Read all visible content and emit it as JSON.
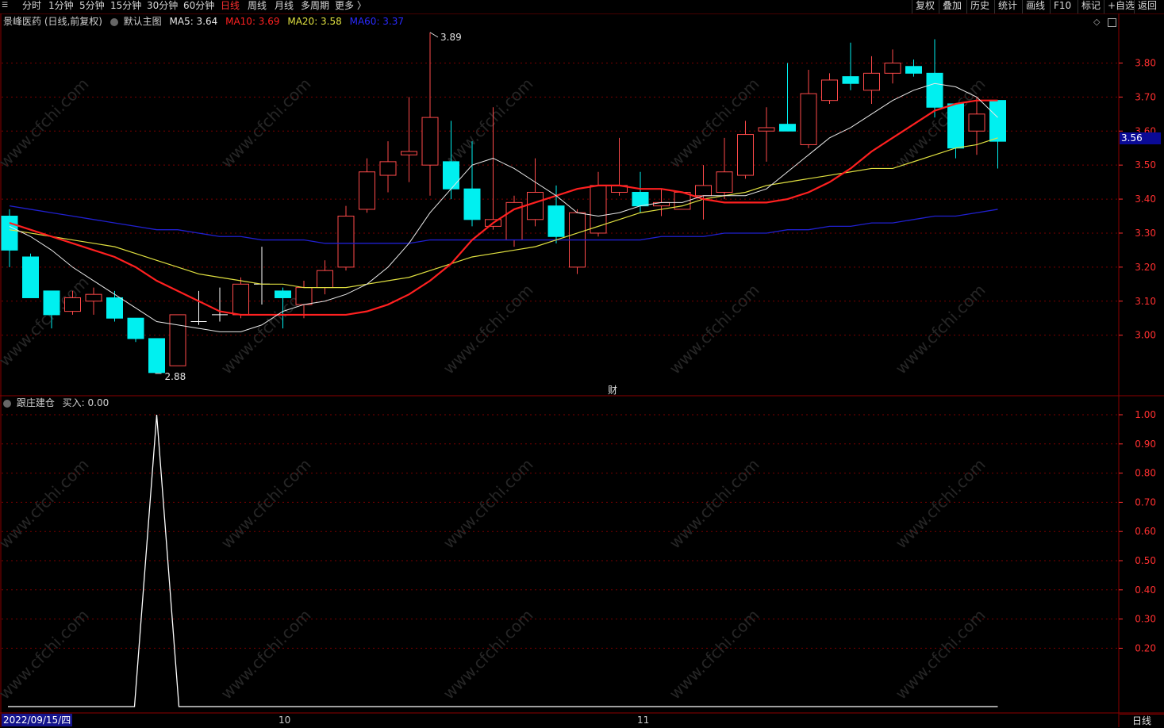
{
  "toolbar": {
    "menu_icon": "window-menu-icon",
    "left_items": [
      "分时",
      "1分钟",
      "5分钟",
      "15分钟",
      "30分钟",
      "60分钟",
      "日线",
      "周线",
      "月线",
      "多周期",
      "更多 〉"
    ],
    "active_item": "日线",
    "right_items": [
      "复权",
      "叠加",
      "历史",
      "统计",
      "画线",
      "F10",
      "标记",
      "+自选",
      "返回"
    ]
  },
  "main_header": {
    "stock": "景峰医药 (日线,前复权)",
    "indicator": "默认主图",
    "ma5": "MA5: 3.64",
    "ma10": "MA10: 3.69",
    "ma20": "MA20: 3.58",
    "ma60": "MA60: 3.37"
  },
  "sub_header": {
    "indicator": "跟庄建仓",
    "buy": "买入: 0.00"
  },
  "current_price_tag": "3.56",
  "high_marker": "3.89",
  "low_marker": "2.88",
  "finance_marker": "财",
  "bottom": {
    "date": "2022/09/15/四",
    "month_labels": [
      "10",
      "11"
    ],
    "period": "日线"
  },
  "watermark": "www.cfchi.com",
  "colors": {
    "up": "#ff4a4a",
    "down": "#00f0f0",
    "ma5": "#e8e8e8",
    "ma10": "#ff2020",
    "ma20": "#e0e040",
    "ma60": "#2020d0",
    "grid": "#7a0000",
    "axis_text": "#ff3030"
  },
  "chart_data": [
    {
      "type": "candlestick",
      "title": "景峰医药 (日线,前复权)",
      "ylim": [
        2.85,
        3.92
      ],
      "y_ticks": [
        3.0,
        3.1,
        3.2,
        3.3,
        3.4,
        3.5,
        3.6,
        3.7,
        3.8
      ],
      "candles": [
        {
          "o": 3.35,
          "h": 3.37,
          "l": 3.2,
          "c": 3.25
        },
        {
          "o": 3.23,
          "h": 3.24,
          "l": 3.11,
          "c": 3.11
        },
        {
          "o": 3.13,
          "h": 3.13,
          "l": 3.02,
          "c": 3.06
        },
        {
          "o": 3.07,
          "h": 3.13,
          "l": 3.06,
          "c": 3.11
        },
        {
          "o": 3.1,
          "h": 3.14,
          "l": 3.06,
          "c": 3.12
        },
        {
          "o": 3.11,
          "h": 3.13,
          "l": 3.04,
          "c": 3.05
        },
        {
          "o": 3.05,
          "h": 3.05,
          "l": 2.98,
          "c": 2.99
        },
        {
          "o": 2.99,
          "h": 2.99,
          "l": 2.89,
          "c": 2.89
        },
        {
          "o": 2.91,
          "h": 3.06,
          "l": 2.91,
          "c": 3.06
        },
        {
          "o": 3.04,
          "h": 3.13,
          "l": 3.03,
          "c": 3.04
        },
        {
          "o": 3.06,
          "h": 3.14,
          "l": 3.04,
          "c": 3.06
        },
        {
          "o": 3.06,
          "h": 3.17,
          "l": 3.05,
          "c": 3.15
        },
        {
          "o": 3.15,
          "h": 3.26,
          "l": 3.09,
          "c": 3.15
        },
        {
          "o": 3.13,
          "h": 3.14,
          "l": 3.02,
          "c": 3.11
        },
        {
          "o": 3.09,
          "h": 3.16,
          "l": 3.05,
          "c": 3.14
        },
        {
          "o": 3.14,
          "h": 3.22,
          "l": 3.12,
          "c": 3.19
        },
        {
          "o": 3.2,
          "h": 3.38,
          "l": 3.19,
          "c": 3.35
        },
        {
          "o": 3.37,
          "h": 3.52,
          "l": 3.36,
          "c": 3.48
        },
        {
          "o": 3.47,
          "h": 3.57,
          "l": 3.42,
          "c": 3.51
        },
        {
          "o": 3.53,
          "h": 3.7,
          "l": 3.45,
          "c": 3.54
        },
        {
          "o": 3.5,
          "h": 3.89,
          "l": 3.41,
          "c": 3.64
        },
        {
          "o": 3.51,
          "h": 3.63,
          "l": 3.4,
          "c": 3.43
        },
        {
          "o": 3.43,
          "h": 3.57,
          "l": 3.32,
          "c": 3.34
        },
        {
          "o": 3.32,
          "h": 3.67,
          "l": 3.31,
          "c": 3.34
        },
        {
          "o": 3.28,
          "h": 3.41,
          "l": 3.26,
          "c": 3.39
        },
        {
          "o": 3.34,
          "h": 3.52,
          "l": 3.32,
          "c": 3.42
        },
        {
          "o": 3.38,
          "h": 3.44,
          "l": 3.27,
          "c": 3.29
        },
        {
          "o": 3.2,
          "h": 3.37,
          "l": 3.18,
          "c": 3.36
        },
        {
          "o": 3.3,
          "h": 3.48,
          "l": 3.29,
          "c": 3.44
        },
        {
          "o": 3.42,
          "h": 3.58,
          "l": 3.41,
          "c": 3.44
        },
        {
          "o": 3.42,
          "h": 3.48,
          "l": 3.36,
          "c": 3.38
        },
        {
          "o": 3.38,
          "h": 3.43,
          "l": 3.35,
          "c": 3.39
        },
        {
          "o": 3.37,
          "h": 3.42,
          "l": 3.37,
          "c": 3.42
        },
        {
          "o": 3.41,
          "h": 3.5,
          "l": 3.34,
          "c": 3.44
        },
        {
          "o": 3.42,
          "h": 3.58,
          "l": 3.4,
          "c": 3.48
        },
        {
          "o": 3.47,
          "h": 3.63,
          "l": 3.46,
          "c": 3.59
        },
        {
          "o": 3.6,
          "h": 3.67,
          "l": 3.51,
          "c": 3.61
        },
        {
          "o": 3.62,
          "h": 3.8,
          "l": 3.6,
          "c": 3.6
        },
        {
          "o": 3.56,
          "h": 3.78,
          "l": 3.55,
          "c": 3.71
        },
        {
          "o": 3.69,
          "h": 3.77,
          "l": 3.68,
          "c": 3.75
        },
        {
          "o": 3.76,
          "h": 3.86,
          "l": 3.72,
          "c": 3.74
        },
        {
          "o": 3.72,
          "h": 3.82,
          "l": 3.68,
          "c": 3.77
        },
        {
          "o": 3.77,
          "h": 3.84,
          "l": 3.74,
          "c": 3.8
        },
        {
          "o": 3.79,
          "h": 3.81,
          "l": 3.76,
          "c": 3.77
        },
        {
          "o": 3.77,
          "h": 3.87,
          "l": 3.64,
          "c": 3.67
        },
        {
          "o": 3.68,
          "h": 3.68,
          "l": 3.52,
          "c": 3.55
        },
        {
          "o": 3.6,
          "h": 3.7,
          "l": 3.53,
          "c": 3.65
        },
        {
          "o": 3.69,
          "h": 3.69,
          "l": 3.49,
          "c": 3.57
        }
      ],
      "ma5": [
        3.32,
        3.29,
        3.25,
        3.2,
        3.16,
        3.12,
        3.08,
        3.04,
        3.03,
        3.02,
        3.01,
        3.01,
        3.03,
        3.07,
        3.09,
        3.1,
        3.12,
        3.15,
        3.2,
        3.27,
        3.36,
        3.43,
        3.5,
        3.52,
        3.49,
        3.45,
        3.41,
        3.36,
        3.35,
        3.36,
        3.38,
        3.39,
        3.39,
        3.41,
        3.41,
        3.41,
        3.43,
        3.48,
        3.53,
        3.58,
        3.61,
        3.65,
        3.69,
        3.72,
        3.74,
        3.73,
        3.7,
        3.64
      ],
      "ma10": [
        3.33,
        3.31,
        3.29,
        3.27,
        3.25,
        3.23,
        3.2,
        3.16,
        3.13,
        3.1,
        3.07,
        3.06,
        3.06,
        3.06,
        3.06,
        3.06,
        3.06,
        3.07,
        3.09,
        3.12,
        3.16,
        3.21,
        3.28,
        3.33,
        3.37,
        3.39,
        3.41,
        3.43,
        3.44,
        3.44,
        3.43,
        3.43,
        3.42,
        3.4,
        3.39,
        3.39,
        3.39,
        3.4,
        3.42,
        3.45,
        3.49,
        3.54,
        3.58,
        3.62,
        3.66,
        3.68,
        3.69,
        3.69
      ],
      "ma20": [
        3.31,
        3.3,
        3.29,
        3.28,
        3.27,
        3.26,
        3.24,
        3.22,
        3.2,
        3.18,
        3.17,
        3.16,
        3.15,
        3.15,
        3.14,
        3.14,
        3.14,
        3.15,
        3.16,
        3.17,
        3.19,
        3.21,
        3.23,
        3.24,
        3.25,
        3.26,
        3.28,
        3.3,
        3.32,
        3.34,
        3.36,
        3.37,
        3.38,
        3.4,
        3.41,
        3.42,
        3.44,
        3.45,
        3.46,
        3.47,
        3.48,
        3.49,
        3.49,
        3.51,
        3.53,
        3.55,
        3.56,
        3.58
      ],
      "ma60": [
        3.38,
        3.37,
        3.36,
        3.35,
        3.34,
        3.33,
        3.32,
        3.31,
        3.31,
        3.3,
        3.29,
        3.29,
        3.28,
        3.28,
        3.28,
        3.27,
        3.27,
        3.27,
        3.27,
        3.27,
        3.28,
        3.28,
        3.28,
        3.28,
        3.28,
        3.28,
        3.28,
        3.28,
        3.28,
        3.28,
        3.28,
        3.29,
        3.29,
        3.29,
        3.3,
        3.3,
        3.3,
        3.31,
        3.31,
        3.32,
        3.32,
        3.33,
        3.33,
        3.34,
        3.35,
        3.35,
        3.36,
        3.37
      ]
    },
    {
      "type": "line",
      "title": "跟庄建仓",
      "series": [
        {
          "name": "买入",
          "values": [
            0,
            0,
            0,
            0,
            0,
            0,
            0,
            1,
            0,
            0,
            0,
            0,
            0,
            0,
            0,
            0,
            0,
            0,
            0,
            0,
            0,
            0,
            0,
            0,
            0,
            0,
            0,
            0,
            0,
            0,
            0,
            0,
            0,
            0,
            0,
            0,
            0,
            0,
            0,
            0,
            0,
            0,
            0,
            0,
            0,
            0,
            0,
            0
          ]
        }
      ],
      "ylim": [
        0,
        1.0
      ],
      "y_ticks": [
        0.2,
        0.3,
        0.4,
        0.5,
        0.6,
        0.7,
        0.8,
        0.9,
        1.0
      ]
    }
  ]
}
